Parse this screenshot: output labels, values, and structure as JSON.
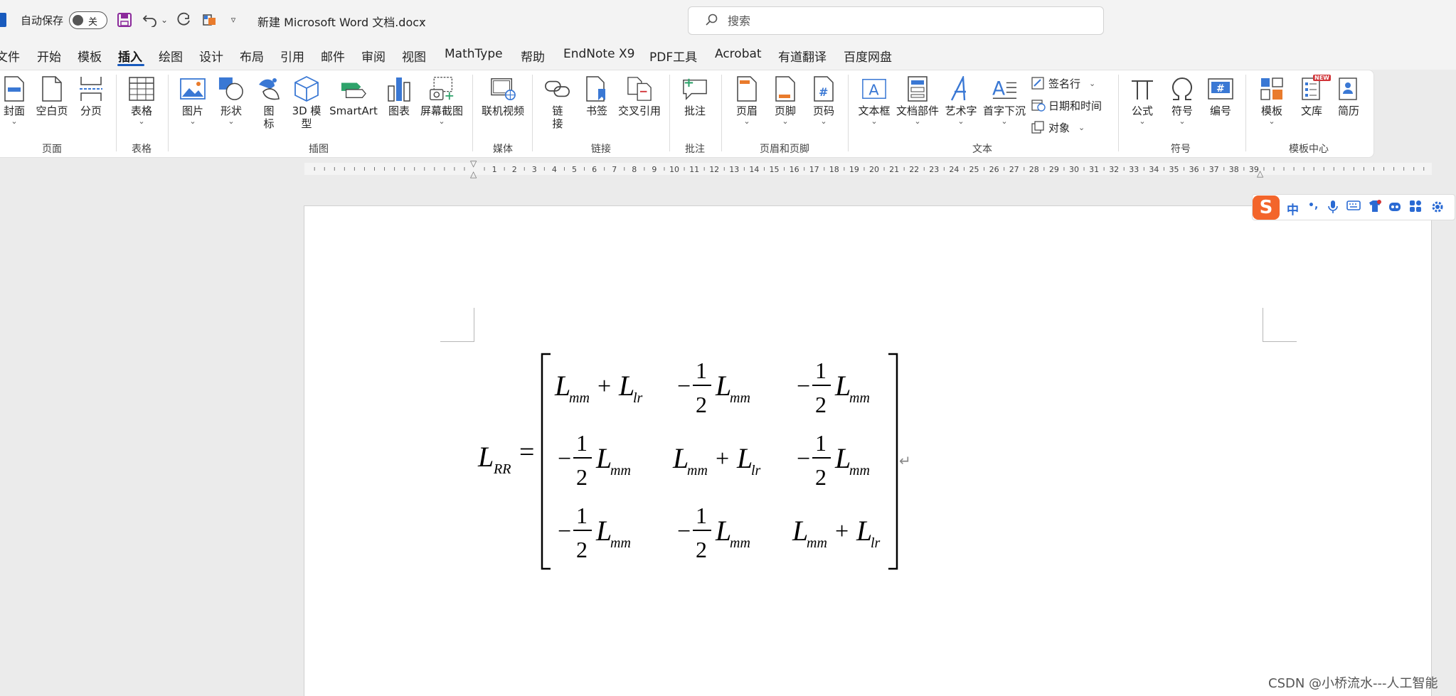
{
  "titlebar": {
    "autosave_label": "自动保存",
    "autosave_state": "关",
    "doc_title": "新建 Microsoft Word 文档.docx",
    "search_placeholder": "搜索"
  },
  "menu": {
    "tabs": [
      "文件",
      "开始",
      "模板",
      "插入",
      "绘图",
      "设计",
      "布局",
      "引用",
      "邮件",
      "审阅",
      "视图",
      "MathType",
      "帮助",
      "EndNote X9",
      "PDF工具",
      "Acrobat",
      "有道翻译",
      "百度网盘"
    ],
    "active_tab": "插入"
  },
  "ribbon": {
    "page": {
      "cover": "封面",
      "blank": "空白页",
      "break": "分页",
      "group": "页面"
    },
    "table": {
      "table": "表格",
      "group": "表格"
    },
    "illustrations": {
      "picture": "图片",
      "shapes": "形状",
      "icons": "图标",
      "model3d": "3D 模型",
      "smartart": "SmartArt",
      "chart": "图表",
      "screenshot": "屏幕截图",
      "group": "插图"
    },
    "media": {
      "video": "联机视频",
      "group": "媒体"
    },
    "links": {
      "link": "链接",
      "bookmark": "书签",
      "xref": "交叉引用",
      "group": "链接"
    },
    "comments": {
      "comment": "批注",
      "group": "批注"
    },
    "header_footer": {
      "header": "页眉",
      "footer": "页脚",
      "page_number": "页码",
      "group": "页眉和页脚"
    },
    "text": {
      "textbox": "文本框",
      "quickparts": "文档部件",
      "wordart": "艺术字",
      "dropcap": "首字下沉",
      "signature": "签名行",
      "datetime": "日期和时间",
      "object": "对象",
      "group": "文本"
    },
    "symbols": {
      "equation": "公式",
      "symbol": "符号",
      "numbering": "编号",
      "group": "符号"
    },
    "templates": {
      "template": "模板",
      "library": "文库",
      "resume": "简历",
      "group": "模板中心",
      "new_badge": "NEW"
    }
  },
  "ruler": {
    "numbers": [
      "1",
      "2",
      "3",
      "4",
      "5",
      "6",
      "7",
      "8",
      "9",
      "10",
      "11",
      "12",
      "13",
      "14",
      "15",
      "16",
      "17",
      "18",
      "19",
      "20",
      "21",
      "22",
      "23",
      "24",
      "25",
      "26",
      "27",
      "28",
      "29",
      "30",
      "31",
      "32",
      "33",
      "34",
      "35",
      "36",
      "37",
      "38",
      "39"
    ]
  },
  "equation": {
    "lhs": "L",
    "lhs_sub": "RR",
    "equals": "=",
    "main_var": "L",
    "sub_mm": "mm",
    "sub_lr": "lr",
    "plus": "+",
    "minus": "−",
    "frac_num": "1",
    "frac_den": "2",
    "paragraph_mark": "↵"
  },
  "ime": {
    "logo": "S",
    "mode": "中",
    "punct": "•,"
  },
  "watermark": "CSDN @小桥流水---人工智能",
  "colors": {
    "accent": "#185abd",
    "ime": "#f3652b"
  }
}
